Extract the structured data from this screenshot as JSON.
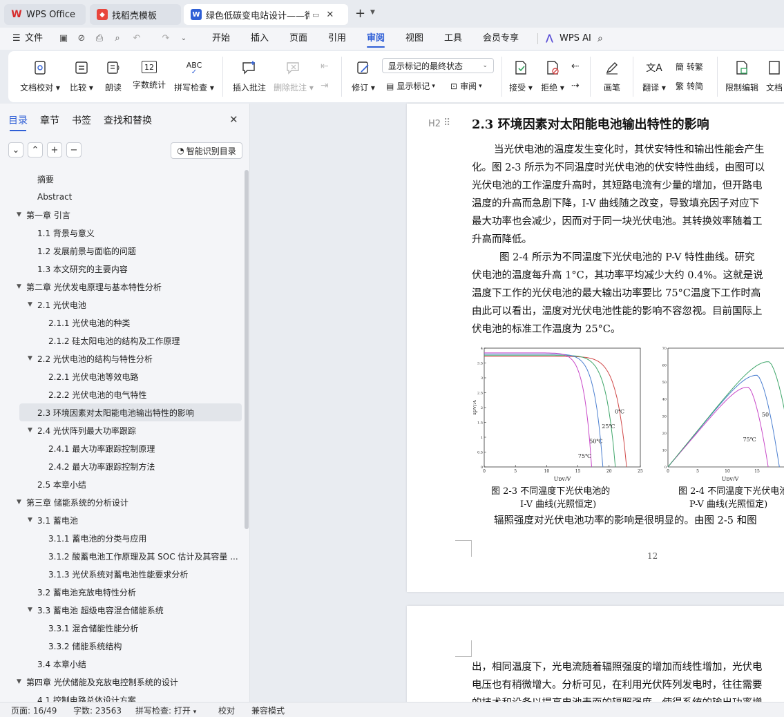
{
  "tabs": [
    {
      "label": "WPS Office",
      "icon": "wps-logo-icon",
      "color": "#d62b2b"
    },
    {
      "label": "找稻壳模板",
      "icon": "docer-icon",
      "color": "#e8453c"
    },
    {
      "label": "绿色低碳变电站设计——微型",
      "icon": "word-doc-icon",
      "color": "#2f5fd6"
    }
  ],
  "menubar": {
    "file": "文件",
    "items": [
      "开始",
      "插入",
      "页面",
      "引用",
      "审阅",
      "视图",
      "工具",
      "会员专享"
    ],
    "active": "审阅",
    "ai": "WPS AI"
  },
  "ribbon": {
    "doc_proofread": "文档校对",
    "compare": "比较",
    "read_aloud": "朗读",
    "word_count": "字数统计",
    "word_count_icon_text": "12",
    "spell_check": "拼写检查",
    "spell_icon_text": "ABC",
    "insert_comment": "插入批注",
    "delete_comment": "删除批注",
    "track_changes": "修订",
    "markup_state": "显示标记的最终状态",
    "show_markup": "显示标记",
    "review_pane": "审阅",
    "accept": "接受",
    "reject": "拒绝",
    "pen": "画笔",
    "translate": "翻译",
    "to_traditional": "转繁",
    "to_simplified": "转简",
    "restrict_edit": "限制编辑",
    "doc_rights": "文档"
  },
  "nav": {
    "tabs": [
      "目录",
      "章节",
      "书签",
      "查找和替换"
    ],
    "smart_toc": "智能识别目录",
    "items": [
      {
        "label": "摘要",
        "level": 1,
        "arrow": ""
      },
      {
        "label": "Abstract",
        "level": 1,
        "arrow": ""
      },
      {
        "label": "第一章  引言",
        "level": 0,
        "arrow": "▼"
      },
      {
        "label": "1.1 背景与意义",
        "level": 1,
        "arrow": ""
      },
      {
        "label": "1.2 发展前景与面临的问题",
        "level": 1,
        "arrow": ""
      },
      {
        "label": "1.3  本文研究的主要内容",
        "level": 1,
        "arrow": ""
      },
      {
        "label": "第二章     光伏发电原理与基本特性分析",
        "level": 0,
        "arrow": "▼"
      },
      {
        "label": "2.1  光伏电池",
        "level": 1,
        "arrow": "▼"
      },
      {
        "label": "2.1.1  光伏电池的种类",
        "level": 2,
        "arrow": ""
      },
      {
        "label": "2.1.2 硅太阳电池的结构及工作原理",
        "level": 2,
        "arrow": ""
      },
      {
        "label": "2.2 光伏电池的结构与特性分析",
        "level": 1,
        "arrow": "▼"
      },
      {
        "label": "2.2.1 光伏电池等效电路",
        "level": 2,
        "arrow": ""
      },
      {
        "label": "2.2.2 光伏电池的电气特性",
        "level": 2,
        "arrow": ""
      },
      {
        "label": "2.3  环境因素对太阳能电池输出特性的影响",
        "level": 1,
        "arrow": "",
        "selected": true
      },
      {
        "label": "2.4 光伏阵列最大功率跟踪",
        "level": 1,
        "arrow": "▼"
      },
      {
        "label": "2.4.1 最大功率跟踪控制原理",
        "level": 2,
        "arrow": ""
      },
      {
        "label": "2.4.2  最大功率跟踪控制方法",
        "level": 2,
        "arrow": ""
      },
      {
        "label": "2.5  本章小结",
        "level": 1,
        "arrow": ""
      },
      {
        "label": "第三章  储能系统的分析设计",
        "level": 0,
        "arrow": "▼"
      },
      {
        "label": "3.1  蓄电池",
        "level": 1,
        "arrow": "▼"
      },
      {
        "label": "3.1.1 蓄电池的分类与应用",
        "level": 2,
        "arrow": ""
      },
      {
        "label": "3.1.2 酸蓄电池工作原理及其 SOC 估计及其容量 ...",
        "level": 2,
        "arrow": ""
      },
      {
        "label": "3.1.3  光伏系统对蓄电池性能要求分析",
        "level": 2,
        "arrow": ""
      },
      {
        "label": "3.2 蓄电池充放电特性分析",
        "level": 1,
        "arrow": ""
      },
      {
        "label": "3.3  蓄电池  超级电容混合储能系统",
        "level": 1,
        "arrow": "▼"
      },
      {
        "label": "3.3.1  混合储能性能分析",
        "level": 2,
        "arrow": ""
      },
      {
        "label": "3.3.2  储能系统结构",
        "level": 2,
        "arrow": ""
      },
      {
        "label": "3.4 本章小结",
        "level": 1,
        "arrow": ""
      },
      {
        "label": "第四章  光伏储能及充放电控制系统的设计",
        "level": 0,
        "arrow": "▼"
      },
      {
        "label": "4.1 控制电路总体设计方案",
        "level": 1,
        "arrow": ""
      }
    ]
  },
  "doc": {
    "heading_marker": "H2",
    "heading": "2.3  环境因素对太阳能电池输出特性的影响",
    "para1": [
      "当光伏电池的温度发生变化时，其伏安特性和输出性能会产生",
      "化。图 2-3 所示为不同温度时光伏电池的伏安特性曲线，由图可以",
      "光伏电池的工作温度升高时，其短路电流有少量的增加，但开路电",
      "温度的升高而急剧下降，I-V 曲线随之改变，导致填充因子对应下",
      "最大功率也会减少，因而对于同一块光伏电池。其转换效率随着工",
      "升高而降低。"
    ],
    "para2": [
      "图  2-4  所示为不同温度下光伏电池的  P-V  特性曲线。研究",
      "伏电池的温度每升高  1°C，其功率平均减少大约 0.4%。这就是说",
      "温度下工作的光伏电池的最大输出功率要比  75°C温度下工作时高",
      "由此可以看出，温度对光伏电池性能的影响不容忽视。目前国际上",
      "伏电池的标准工作温度为  25°C。"
    ],
    "fig1_caption": [
      "图 2-3 不同温度下光伏电池的",
      "I-V  曲线(光照恒定)"
    ],
    "fig2_caption": [
      "图 2-4 不同温度下光伏电池",
      "P-V  曲线(光照恒定)"
    ],
    "para3": "辐照强度对光伏电池功率的影响是很明显的。由图  2-5 和图",
    "page_number": "12",
    "page2": [
      "出，相同温度下，光电流随着辐照强度的增加而线性增加，光伏电",
      "电压也有稍微增大。分析可见，在利用光伏阵列发电时，往往需要",
      "的技术和设备以提高电池表面的辐照强度，使得系统的输出功率增"
    ]
  },
  "chart_data": [
    {
      "type": "line",
      "title": "图 2-3 不同温度下光伏电池的 I-V 曲线(光照恒定)",
      "xlabel": "Upv/V",
      "ylabel": "Ipv/A",
      "xlim": [
        0,
        25
      ],
      "ylim": [
        0,
        4
      ],
      "xticks": [
        0,
        5,
        10,
        15,
        20,
        25
      ],
      "yticks": [
        0,
        0.5,
        1,
        1.5,
        2,
        2.5,
        3,
        3.5,
        4
      ],
      "series": [
        {
          "name": "0℃",
          "color": "#d04848",
          "isc": 3.72,
          "voc": 22.8
        },
        {
          "name": "25℃",
          "color": "#3fa66a",
          "isc": 3.76,
          "voc": 21.0
        },
        {
          "name": "50℃",
          "color": "#4b7fd0",
          "isc": 3.8,
          "voc": 19.0
        },
        {
          "name": "75℃",
          "color": "#c848c8",
          "isc": 3.84,
          "voc": 17.2
        }
      ]
    },
    {
      "type": "line",
      "title": "图 2-4 不同温度下光伏电池 P-V 曲线(光照恒定)",
      "xlabel": "Upv/V",
      "ylabel": "Ppv/A",
      "xlim": [
        0,
        20
      ],
      "ylim": [
        0,
        70
      ],
      "xticks": [
        0,
        5,
        10,
        15
      ],
      "yticks": [
        0,
        10,
        20,
        30,
        40,
        50,
        60,
        70
      ],
      "series": [
        {
          "name": "50",
          "color": "#4b7fd0",
          "peak_v": 15,
          "peak_p": 54
        },
        {
          "name": "75℃",
          "color": "#c848c8",
          "peak_v": 13.5,
          "peak_p": 47
        },
        {
          "name": "",
          "color": "#3fa66a",
          "peak_v": 17,
          "peak_p": 62
        }
      ]
    }
  ],
  "status": {
    "page": "页面: 16/49",
    "words": "字数: 23563",
    "spell": "拼写检查: 打开",
    "proofread": "校对",
    "compat": "兼容模式"
  }
}
